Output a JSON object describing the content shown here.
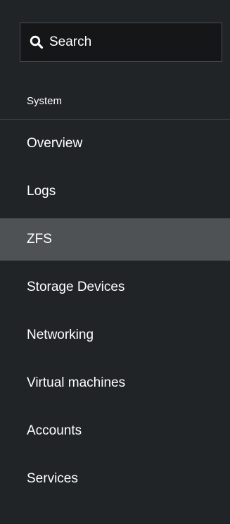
{
  "search": {
    "placeholder": "Search",
    "icon": "search-icon"
  },
  "section": {
    "label": "System"
  },
  "nav": {
    "active_color": "#4f5255",
    "items": [
      {
        "label": "Overview"
      },
      {
        "label": "Logs"
      },
      {
        "label": "ZFS",
        "active": true
      },
      {
        "label": "Storage Devices"
      },
      {
        "label": "Networking"
      },
      {
        "label": "Virtual machines"
      },
      {
        "label": "Accounts"
      },
      {
        "label": "Services"
      }
    ]
  }
}
